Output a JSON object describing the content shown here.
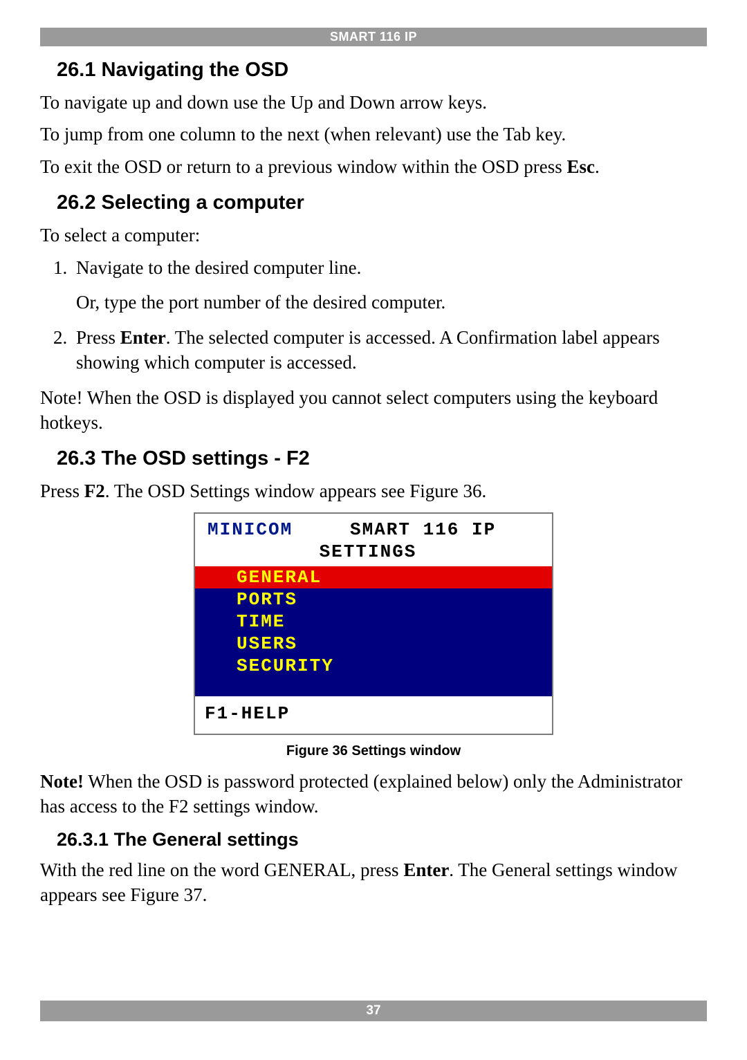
{
  "header": {
    "title": "SMART 116 IP"
  },
  "sections": {
    "s261_title": "26.1 Navigating the OSD",
    "s261_p1": "To navigate up and down use the Up and Down arrow keys.",
    "s261_p2": "To jump from one column to the next (when relevant) use the Tab key.",
    "s261_p3a": "To exit the OSD or return to a previous window within the OSD press ",
    "s261_p3b": "Esc",
    "s261_p3c": ".",
    "s262_title": "26.2 Selecting a computer",
    "s262_p1": "To select a computer:",
    "s262_li1": "Navigate to the desired computer line.",
    "s262_li1b": "Or, type the port number of the desired computer.",
    "s262_li2a": "Press ",
    "s262_li2b": "Enter",
    "s262_li2c": ". The selected computer is accessed. A Confirmation label appears showing which computer is accessed.",
    "s262_note": "Note! When the OSD is displayed you cannot select computers using the keyboard hotkeys.",
    "s263_title": "26.3 The OSD settings - F2",
    "s263_p1a": "Press ",
    "s263_p1b": "F2",
    "s263_p1c": ". The OSD Settings window appears see Figure 36.",
    "fig_caption": "Figure 36 Settings window",
    "s263_noteA": "Note!",
    "s263_noteB": " When the OSD is password protected (explained below) only the Administrator has access to the F2 settings window.",
    "s2631_title": "26.3.1 The General settings",
    "s2631_p1a": "With the red line on the word GENERAL, press ",
    "s2631_p1b": "Enter",
    "s2631_p1c": ". The General settings window appears see Figure 37."
  },
  "osd": {
    "brand": "MINICOM",
    "title1": "SMART 116 IP",
    "title2": "SETTINGS",
    "items": [
      "GENERAL",
      "PORTS",
      "TIME",
      "USERS",
      "SECURITY"
    ],
    "selected_index": 0,
    "footer": "F1-HELP"
  },
  "footer": {
    "page": "37"
  }
}
